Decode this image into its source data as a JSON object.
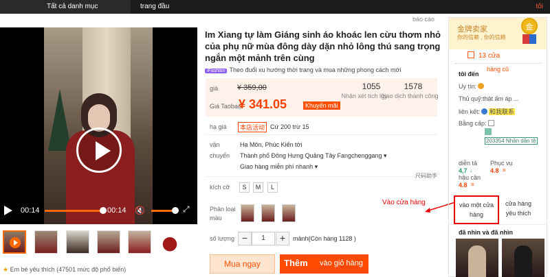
{
  "topbar": {
    "categories": "Tất cả danh mục",
    "home": "trang đầu",
    "user": "tôi"
  },
  "report": "báo cáo",
  "video": {
    "time_current": "00:14",
    "time_total": "00:14"
  },
  "product": {
    "title": "Im Xiang tự làm Giáng sinh áo khoác len cừu thơm nhỏ của phụ nữ mùa đông dày dặn nhỏ lông thú sang trọng ngắn một mảnh trên cùng",
    "fashion_badge": "iFashion",
    "fashion_text": "Theo đuổi xu hướng thời trang và mua những phong cách mới"
  },
  "price": {
    "price_label": "giá",
    "original": "¥ 359,00",
    "taobao_label": "Giá Taobao",
    "current": "¥ 341.05",
    "promo": "Khuyến mãi",
    "reviews_value": "1055",
    "reviews_label": "Nhận xét tích lũy",
    "transactions_value": "1578",
    "transactions_label": "giao dịch thành công"
  },
  "discount": {
    "label": "hạ giá",
    "tag": "本店活动",
    "text": "Cứ 200 trừ 15"
  },
  "shipping": {
    "label1": "vận",
    "label2": "chuyển",
    "from": "Hạ Môn, Phúc Kiến tới",
    "to": "Thành phố Đông Hưng Quảng Tây Fangchenggang",
    "free": "Giao hàng miễn phí nhanh"
  },
  "size_helper": "尺码助手",
  "size": {
    "label": "kích cỡ",
    "options": [
      "S",
      "M",
      "L"
    ]
  },
  "color": {
    "label1": "Phân loại",
    "label2": "màu"
  },
  "quantity": {
    "label": "số lượng",
    "minus": "−",
    "value": "1",
    "plus": "+",
    "stock": "mảnh(Còn hàng 1128 )"
  },
  "actions": {
    "buy": "Mua ngay",
    "cart_a": "Thêm",
    "cart_b": "vào giỏ hàng"
  },
  "annotation": "Vào cửa hàng",
  "favorites": {
    "star": "★",
    "text": "Em bé yêu thích (47501 mức độ phổ biến)"
  },
  "seller": {
    "gold_title": "金牌卖家",
    "gold_sub": "你的信赖 , 你的信赖",
    "medal": "金",
    "shop": "13 cửa",
    "shop_old": "hàng cũ",
    "heading": "tôi đến",
    "credit_label": "Uy tín:",
    "service_label": "Thủ quỹ:",
    "service_value": "thật ấm áp ...",
    "contact_label": "liên kết:",
    "contact_value": "和我联系",
    "cert_label": "Bằng cấp:",
    "cert_value": "203354 Nhân dân tệ",
    "desc_label": "diễn tả",
    "desc_value": "4,7",
    "service_score_label": "Phục vụ",
    "service_score_value": "4.8",
    "logistics_label": "hậu cần",
    "logistics_value": "4.8",
    "enter_shop": "vào một cửa hàng",
    "fav_shop": "cửa hàng yêu thích",
    "seen_title": "đã nhìn và đã nhìn"
  },
  "colors": {
    "accent": "#ff5000",
    "red_annotation": "#e00000"
  }
}
